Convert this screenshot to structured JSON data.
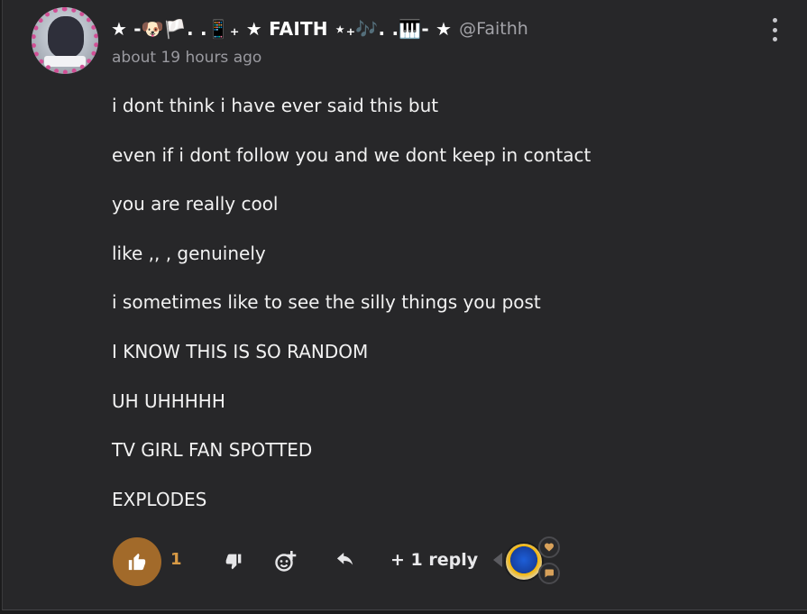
{
  "post": {
    "author": {
      "display_name": "★ -🐶🏳️. .📱₊ ★ FAITH ⋆₊🎶. .🎹- ★",
      "handle": "@Faithh"
    },
    "timestamp": "about 19 hours ago",
    "lines": [
      "i dont think i have ever said this but",
      "even if i dont follow you and we dont keep in contact",
      "you are really cool",
      "like ,, , genuinely",
      "i sometimes like to see the silly things you post",
      "I KNOW THIS IS SO RANDOM",
      "UH UHHHHH",
      "TV GIRL FAN SPOTTED",
      "EXPLODES"
    ],
    "actions": {
      "like_count": "1",
      "replies_label": "+ 1 reply"
    },
    "colors": {
      "background": "#272729",
      "like_accent": "#a26a2a",
      "like_count": "#d89a45"
    },
    "icons": {
      "more": "more-vertical-icon",
      "like": "thumbs-up-icon",
      "dislike": "thumbs-down-icon",
      "add_reaction": "add-reaction-icon",
      "reply": "reply-icon",
      "heart": "heart-icon",
      "chat": "chat-bubble-icon"
    }
  }
}
